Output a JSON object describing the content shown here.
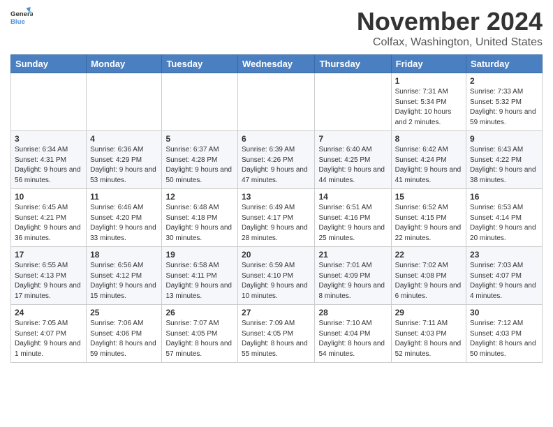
{
  "logo": {
    "line1": "General",
    "line2": "Blue"
  },
  "title": "November 2024",
  "subtitle": "Colfax, Washington, United States",
  "days_of_week": [
    "Sunday",
    "Monday",
    "Tuesday",
    "Wednesday",
    "Thursday",
    "Friday",
    "Saturday"
  ],
  "weeks": [
    [
      {
        "day": "",
        "info": ""
      },
      {
        "day": "",
        "info": ""
      },
      {
        "day": "",
        "info": ""
      },
      {
        "day": "",
        "info": ""
      },
      {
        "day": "",
        "info": ""
      },
      {
        "day": "1",
        "info": "Sunrise: 7:31 AM\nSunset: 5:34 PM\nDaylight: 10 hours and 2 minutes."
      },
      {
        "day": "2",
        "info": "Sunrise: 7:33 AM\nSunset: 5:32 PM\nDaylight: 9 hours and 59 minutes."
      }
    ],
    [
      {
        "day": "3",
        "info": "Sunrise: 6:34 AM\nSunset: 4:31 PM\nDaylight: 9 hours and 56 minutes."
      },
      {
        "day": "4",
        "info": "Sunrise: 6:36 AM\nSunset: 4:29 PM\nDaylight: 9 hours and 53 minutes."
      },
      {
        "day": "5",
        "info": "Sunrise: 6:37 AM\nSunset: 4:28 PM\nDaylight: 9 hours and 50 minutes."
      },
      {
        "day": "6",
        "info": "Sunrise: 6:39 AM\nSunset: 4:26 PM\nDaylight: 9 hours and 47 minutes."
      },
      {
        "day": "7",
        "info": "Sunrise: 6:40 AM\nSunset: 4:25 PM\nDaylight: 9 hours and 44 minutes."
      },
      {
        "day": "8",
        "info": "Sunrise: 6:42 AM\nSunset: 4:24 PM\nDaylight: 9 hours and 41 minutes."
      },
      {
        "day": "9",
        "info": "Sunrise: 6:43 AM\nSunset: 4:22 PM\nDaylight: 9 hours and 38 minutes."
      }
    ],
    [
      {
        "day": "10",
        "info": "Sunrise: 6:45 AM\nSunset: 4:21 PM\nDaylight: 9 hours and 36 minutes."
      },
      {
        "day": "11",
        "info": "Sunrise: 6:46 AM\nSunset: 4:20 PM\nDaylight: 9 hours and 33 minutes."
      },
      {
        "day": "12",
        "info": "Sunrise: 6:48 AM\nSunset: 4:18 PM\nDaylight: 9 hours and 30 minutes."
      },
      {
        "day": "13",
        "info": "Sunrise: 6:49 AM\nSunset: 4:17 PM\nDaylight: 9 hours and 28 minutes."
      },
      {
        "day": "14",
        "info": "Sunrise: 6:51 AM\nSunset: 4:16 PM\nDaylight: 9 hours and 25 minutes."
      },
      {
        "day": "15",
        "info": "Sunrise: 6:52 AM\nSunset: 4:15 PM\nDaylight: 9 hours and 22 minutes."
      },
      {
        "day": "16",
        "info": "Sunrise: 6:53 AM\nSunset: 4:14 PM\nDaylight: 9 hours and 20 minutes."
      }
    ],
    [
      {
        "day": "17",
        "info": "Sunrise: 6:55 AM\nSunset: 4:13 PM\nDaylight: 9 hours and 17 minutes."
      },
      {
        "day": "18",
        "info": "Sunrise: 6:56 AM\nSunset: 4:12 PM\nDaylight: 9 hours and 15 minutes."
      },
      {
        "day": "19",
        "info": "Sunrise: 6:58 AM\nSunset: 4:11 PM\nDaylight: 9 hours and 13 minutes."
      },
      {
        "day": "20",
        "info": "Sunrise: 6:59 AM\nSunset: 4:10 PM\nDaylight: 9 hours and 10 minutes."
      },
      {
        "day": "21",
        "info": "Sunrise: 7:01 AM\nSunset: 4:09 PM\nDaylight: 9 hours and 8 minutes."
      },
      {
        "day": "22",
        "info": "Sunrise: 7:02 AM\nSunset: 4:08 PM\nDaylight: 9 hours and 6 minutes."
      },
      {
        "day": "23",
        "info": "Sunrise: 7:03 AM\nSunset: 4:07 PM\nDaylight: 9 hours and 4 minutes."
      }
    ],
    [
      {
        "day": "24",
        "info": "Sunrise: 7:05 AM\nSunset: 4:07 PM\nDaylight: 9 hours and 1 minute."
      },
      {
        "day": "25",
        "info": "Sunrise: 7:06 AM\nSunset: 4:06 PM\nDaylight: 8 hours and 59 minutes."
      },
      {
        "day": "26",
        "info": "Sunrise: 7:07 AM\nSunset: 4:05 PM\nDaylight: 8 hours and 57 minutes."
      },
      {
        "day": "27",
        "info": "Sunrise: 7:09 AM\nSunset: 4:05 PM\nDaylight: 8 hours and 55 minutes."
      },
      {
        "day": "28",
        "info": "Sunrise: 7:10 AM\nSunset: 4:04 PM\nDaylight: 8 hours and 54 minutes."
      },
      {
        "day": "29",
        "info": "Sunrise: 7:11 AM\nSunset: 4:03 PM\nDaylight: 8 hours and 52 minutes."
      },
      {
        "day": "30",
        "info": "Sunrise: 7:12 AM\nSunset: 4:03 PM\nDaylight: 8 hours and 50 minutes."
      }
    ]
  ]
}
